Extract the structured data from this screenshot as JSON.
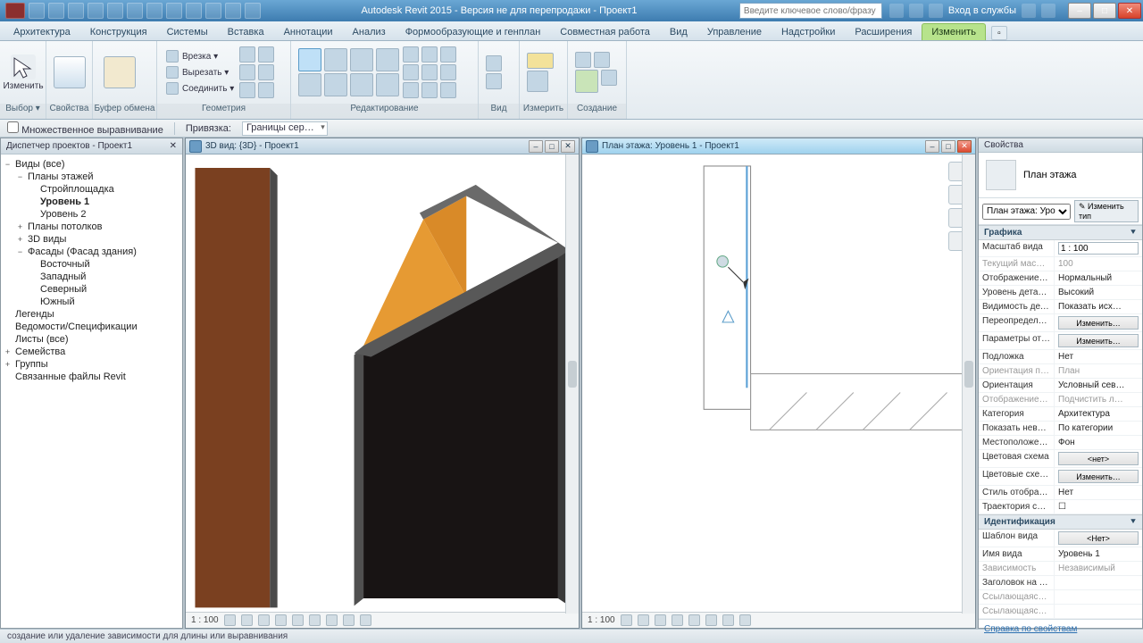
{
  "titlebar": {
    "title": "Autodesk Revit 2015 - Версия не для перепродажи -   Проект1",
    "search_placeholder": "Введите ключевое слово/фразу",
    "signin": "Вход в службы"
  },
  "ribbon_tabs": [
    "Архитектура",
    "Конструкция",
    "Системы",
    "Вставка",
    "Аннотации",
    "Анализ",
    "Формообразующие и генплан",
    "Совместная работа",
    "Вид",
    "Управление",
    "Надстройки",
    "Расширения",
    "Изменить"
  ],
  "active_tab_index": 12,
  "ribbon": {
    "vybor": {
      "title": "Выбор ▾",
      "btn": "Изменить"
    },
    "svoistva": {
      "title": "Свойства"
    },
    "bufer": {
      "title": "Буфер обмена",
      "vrezka": "Врезка ▾",
      "vyrezat": "Вырезать ▾",
      "soedinit": "Соединить ▾"
    },
    "geom": {
      "title": "Геометрия"
    },
    "redakt": {
      "title": "Редактирование"
    },
    "vid": {
      "title": "Вид"
    },
    "izmerit": {
      "title": "Измерить"
    },
    "sozdanie": {
      "title": "Создание"
    }
  },
  "options_bar": {
    "label1": "Множественное выравнивание",
    "label2": "Привязка:",
    "dd": "Границы сер…"
  },
  "browser": {
    "title": "Диспетчер проектов - Проект1",
    "items": [
      {
        "t": "Виды (все)",
        "lvl": 0,
        "tg": "−"
      },
      {
        "t": "Планы этажей",
        "lvl": 1,
        "tg": "−"
      },
      {
        "t": "Стройплощадка",
        "lvl": 2
      },
      {
        "t": "Уровень 1",
        "lvl": 2,
        "bold": true
      },
      {
        "t": "Уровень 2",
        "lvl": 2
      },
      {
        "t": "Планы потолков",
        "lvl": 1,
        "tg": "+"
      },
      {
        "t": "3D виды",
        "lvl": 1,
        "tg": "+"
      },
      {
        "t": "Фасады (Фасад здания)",
        "lvl": 1,
        "tg": "−"
      },
      {
        "t": "Восточный",
        "lvl": 2
      },
      {
        "t": "Западный",
        "lvl": 2
      },
      {
        "t": "Северный",
        "lvl": 2
      },
      {
        "t": "Южный",
        "lvl": 2
      },
      {
        "t": "Легенды",
        "lvl": 0,
        "tg": ""
      },
      {
        "t": "Ведомости/Спецификации",
        "lvl": 0,
        "tg": ""
      },
      {
        "t": "Листы (все)",
        "lvl": 0,
        "tg": ""
      },
      {
        "t": "Семейства",
        "lvl": 0,
        "tg": "+"
      },
      {
        "t": "Группы",
        "lvl": 0,
        "tg": "+"
      },
      {
        "t": "Связанные файлы Revit",
        "lvl": 0,
        "tg": ""
      }
    ]
  },
  "view3d": {
    "title": "3D вид: {3D} - Проект1",
    "scale": "1 : 100"
  },
  "viewplan": {
    "title": "План этажа: Уровень 1 - Проект1",
    "scale": "1 : 100"
  },
  "props": {
    "title": "Свойства",
    "type_label": "План этажа",
    "selector": "План этажа: Уро",
    "edit_type": "Изменить тип",
    "groups": {
      "graphics": "Графика",
      "identity": "Идентификация"
    },
    "rows_graphics": [
      {
        "k": "Масштаб вида",
        "v": "1 : 100",
        "input": true
      },
      {
        "k": "Текущий масш…",
        "v": "100",
        "dim": true
      },
      {
        "k": "Отображение …",
        "v": "Нормальный"
      },
      {
        "k": "Уровень детал…",
        "v": "Высокий"
      },
      {
        "k": "Видимость дет…",
        "v": "Показать исх…"
      },
      {
        "k": "Переопределе…",
        "v": "Изменить…",
        "btn": true
      },
      {
        "k": "Параметры от…",
        "v": "Изменить…",
        "btn": true
      },
      {
        "k": "Подложка",
        "v": "Нет"
      },
      {
        "k": "Ориентация п…",
        "v": "План",
        "dim": true
      },
      {
        "k": "Ориентация",
        "v": "Условный сев…"
      },
      {
        "k": "Отображение …",
        "v": "Подчистить л…",
        "dim": true
      },
      {
        "k": "Категория",
        "v": "Архитектура"
      },
      {
        "k": "Показать неви…",
        "v": "По категории"
      },
      {
        "k": "Местоположе…",
        "v": "Фон"
      },
      {
        "k": "Цветовая схема",
        "v": "<нет>",
        "btn": true
      },
      {
        "k": "Цветовые схе…",
        "v": "Изменить…",
        "btn": true
      },
      {
        "k": "Стиль отображ…",
        "v": "Нет"
      },
      {
        "k": "Траектория со…",
        "v": "☐"
      }
    ],
    "rows_identity": [
      {
        "k": "Шаблон вида",
        "v": "<Нет>",
        "btn": true
      },
      {
        "k": "Имя вида",
        "v": "Уровень 1"
      },
      {
        "k": "Зависимость",
        "v": "Независимый",
        "dim": true
      },
      {
        "k": "Заголовок на л…",
        "v": ""
      },
      {
        "k": "Ссылающаяся…",
        "v": "",
        "dim": true
      },
      {
        "k": "Ссылающаяся…",
        "v": "",
        "dim": true
      }
    ],
    "help": "Справка по свойствам"
  },
  "status_text": "создание или удаление зависимости для длины или выравнивания"
}
